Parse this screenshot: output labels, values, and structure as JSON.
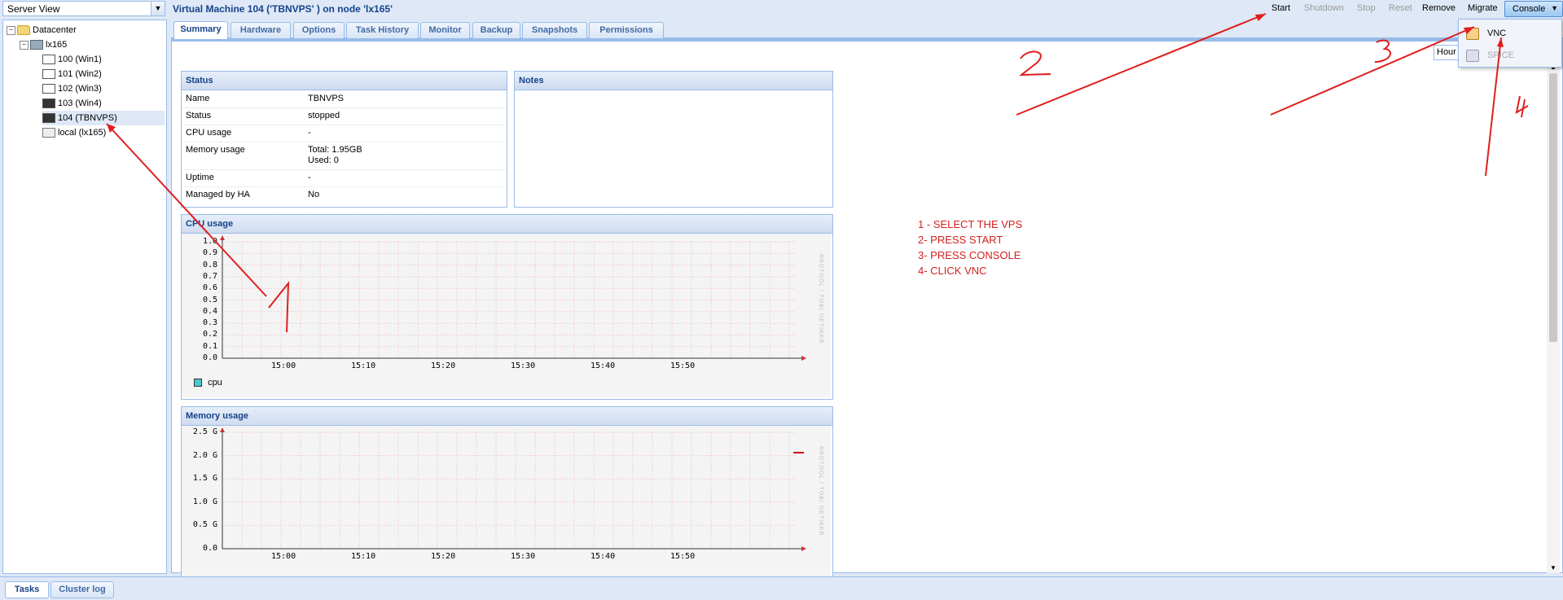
{
  "left": {
    "view_select": "Server View",
    "tree": [
      {
        "label": "Datacenter"
      },
      {
        "label": "lx165"
      },
      {
        "label": "100 (Win1)"
      },
      {
        "label": "101 (Win2)"
      },
      {
        "label": "102 (Win3)"
      },
      {
        "label": "103 (Win4)"
      },
      {
        "label": "104 (TBNVPS)"
      },
      {
        "label": "local (lx165)"
      }
    ]
  },
  "header": {
    "title": "Virtual Machine 104 ('TBNVPS' ) on node 'lx165'",
    "toolbar": {
      "start": "Start",
      "shutdown": "Shutdown",
      "stop": "Stop",
      "reset": "Reset",
      "remove": "Remove",
      "migrate": "Migrate",
      "console": "Console"
    }
  },
  "tabs": [
    "Summary",
    "Hardware",
    "Options",
    "Task History",
    "Monitor",
    "Backup",
    "Snapshots",
    "Permissions"
  ],
  "timeframe": "Hour",
  "console_menu": {
    "vnc": "VNC",
    "spice": "SPICE"
  },
  "status": {
    "title": "Status",
    "rows": [
      {
        "key": "Name",
        "value": "TBNVPS"
      },
      {
        "key": "Status",
        "value": "stopped"
      },
      {
        "key": "CPU usage",
        "value": "-"
      },
      {
        "key": "Memory usage",
        "value": "Total: 1.95GB",
        "value2": "Used: 0"
      },
      {
        "key": "Uptime",
        "value": "-"
      },
      {
        "key": "Managed by HA",
        "value": "No"
      }
    ]
  },
  "notes": {
    "title": "Notes"
  },
  "cpu_graph": {
    "title": "CPU usage",
    "yticks": [
      "1.0",
      "0.9",
      "0.8",
      "0.7",
      "0.6",
      "0.5",
      "0.4",
      "0.3",
      "0.2",
      "0.1",
      "0.0"
    ],
    "xticks": [
      "15:00",
      "15:10",
      "15:20",
      "15:30",
      "15:40",
      "15:50"
    ],
    "legend": "cpu",
    "watermark": "RRDTOOL / TOBI OETIKER"
  },
  "mem_graph": {
    "title": "Memory usage",
    "yticks": [
      "2.5 G",
      "2.0 G",
      "1.5 G",
      "1.0 G",
      "0.5 G",
      "0.0"
    ],
    "xticks": [
      "15:00",
      "15:10",
      "15:20",
      "15:30",
      "15:40",
      "15:50"
    ],
    "watermark": "RRDTOOL / TOBI OETIKER"
  },
  "instructions": [
    "1 - SELECT THE VPS",
    "2- PRESS START",
    "3- PRESS CONSOLE",
    "4- CLICK VNC"
  ],
  "bottom_tabs": [
    "Tasks",
    "Cluster log"
  ]
}
